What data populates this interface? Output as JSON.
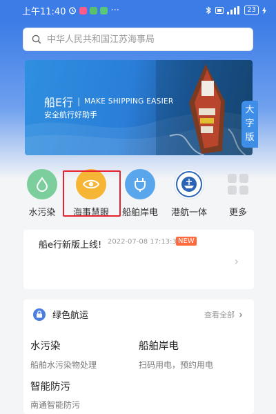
{
  "status_bar": {
    "time": "上午11:40",
    "dots": "···",
    "battery": "23"
  },
  "search": {
    "placeholder": "中华人民共和国江苏海事局"
  },
  "banner": {
    "title": "船E行",
    "separator": "|",
    "subtitle_en": "MAKE SHIPPING EASIER",
    "slogan": "安全航行好助手"
  },
  "big_font_toggle": {
    "label": "大字版"
  },
  "quick_actions": [
    {
      "label": "水污染",
      "icon": "water-drop-icon",
      "color": "#7ccf9d"
    },
    {
      "label": "海事慧眼",
      "icon": "eye-icon",
      "color": "#f7b536"
    },
    {
      "label": "船舶岸电",
      "icon": "plug-icon",
      "color": "#5aa6ec"
    },
    {
      "label": "港航一体",
      "icon": "maritime-emblem-icon",
      "color": "#2b64b6"
    },
    {
      "label": "更多",
      "icon": "grid-icon",
      "color": "#d7d9dd"
    }
  ],
  "news": {
    "title": "船e行新版上线!",
    "time": "2022-07-08 17:13:35",
    "badge": "NEW"
  },
  "green_shipping": {
    "title": "绿色航运",
    "view_all": "查看全部",
    "items": [
      {
        "title": "水污染",
        "desc": "船舶水污染物处理"
      },
      {
        "title": "船舶岸电",
        "desc": "扫码用电，预约用电"
      },
      {
        "title": "智能防污",
        "desc": "南通智能防污"
      }
    ]
  },
  "colors": {
    "primary": "#3b7ce6",
    "highlight_border": "#e8202c",
    "new_badge": "#ff6a3d"
  }
}
